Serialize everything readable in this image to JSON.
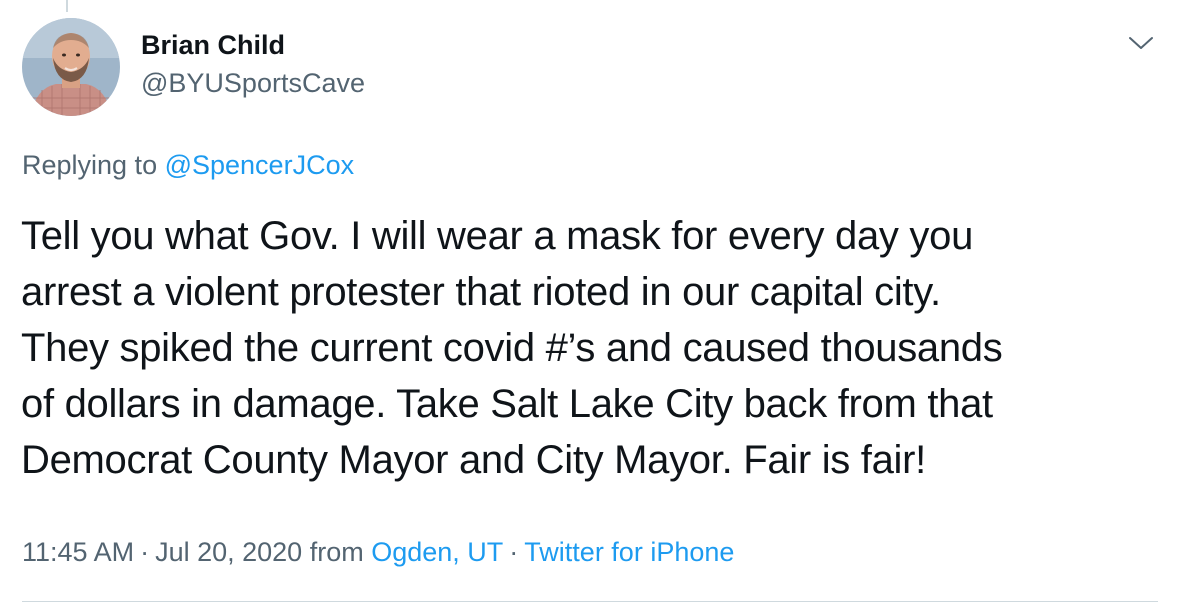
{
  "author": {
    "display_name": "Brian Child",
    "handle": "@BYUSportsCave"
  },
  "reply": {
    "prefix": "Replying to ",
    "mention": "@SpencerJCox"
  },
  "tweet": {
    "lines": [
      "Tell you what Gov. I will wear a mask for every day you",
      "arrest a violent protester that rioted in our capital city.",
      "They spiked the current covid #’s and caused thousands",
      "of dollars in damage. Take Salt Lake City back from that",
      "Democrat County Mayor and City Mayor. Fair is fair!"
    ]
  },
  "meta": {
    "time": "11:45 AM",
    "sep1": "·",
    "date": "Jul 20, 2020",
    "from": "from",
    "location": "Ogden, UT",
    "sep2": "·",
    "source": "Twitter for iPhone"
  },
  "icons": {
    "more": "chevron-down-icon",
    "avatar": "avatar"
  },
  "colors": {
    "link": "#1d9bf0",
    "secondary_text": "#536471",
    "primary_text": "#0f1419",
    "divider": "#cfd9de"
  }
}
